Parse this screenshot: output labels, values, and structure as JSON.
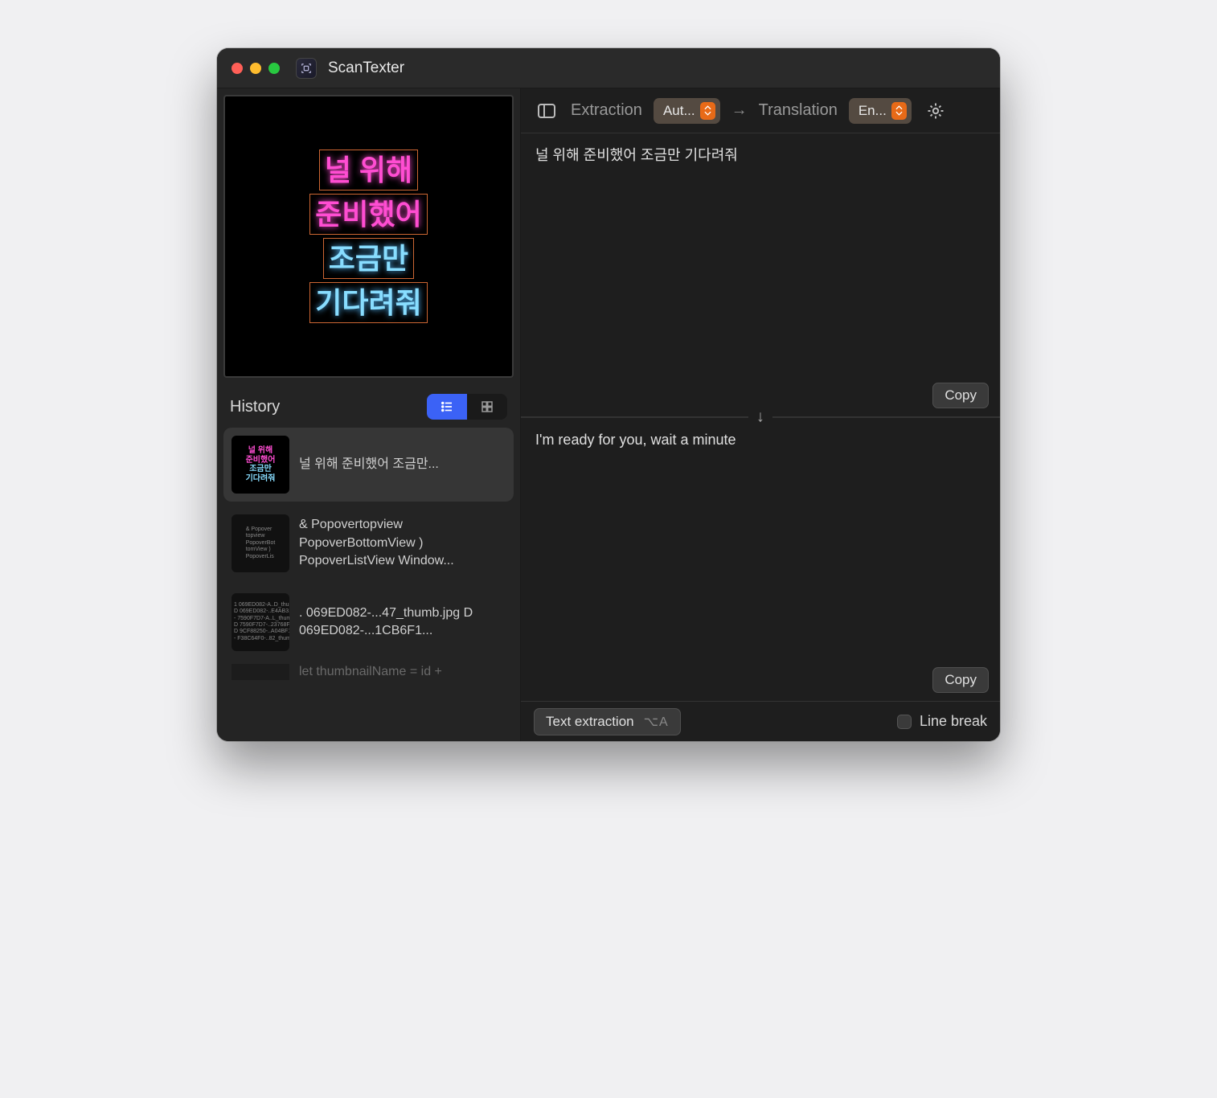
{
  "app": {
    "title": "ScanTexter"
  },
  "preview": {
    "lines": [
      "널  위해",
      "준비했어",
      "조금만",
      "기다려줘"
    ],
    "line_colors": [
      "pink",
      "pink",
      "blue",
      "blue"
    ]
  },
  "sidebar": {
    "history_label": "History",
    "view_mode": "list",
    "items": [
      {
        "preview": "널 위해\n준비했어\n조금만...",
        "selected": true,
        "thumb_kind": "neon"
      },
      {
        "preview": "& Popovertopview PopoverBottomView ) PopoverListView Window...",
        "selected": false,
        "thumb_kind": "code"
      },
      {
        "preview": ". 069ED082-...47_thumb.jpg D 069ED082-...1CB6F1...",
        "selected": false,
        "thumb_kind": "code"
      },
      {
        "preview": "let thumbnailName = id +",
        "selected": false,
        "thumb_kind": "code"
      }
    ]
  },
  "toolbar": {
    "extraction_label": "Extraction",
    "translation_label": "Translation",
    "extraction_lang": "Aut...",
    "translation_lang": "En..."
  },
  "panes": {
    "source_text": "널 위해 준비했어 조금만 기다려줘",
    "translated_text": "I'm ready for you, wait a minute",
    "copy_label": "Copy"
  },
  "bottom": {
    "text_extraction_label": "Text extraction",
    "text_extraction_shortcut": "⌥A",
    "line_break_label": "Line break",
    "line_break_checked": false
  }
}
